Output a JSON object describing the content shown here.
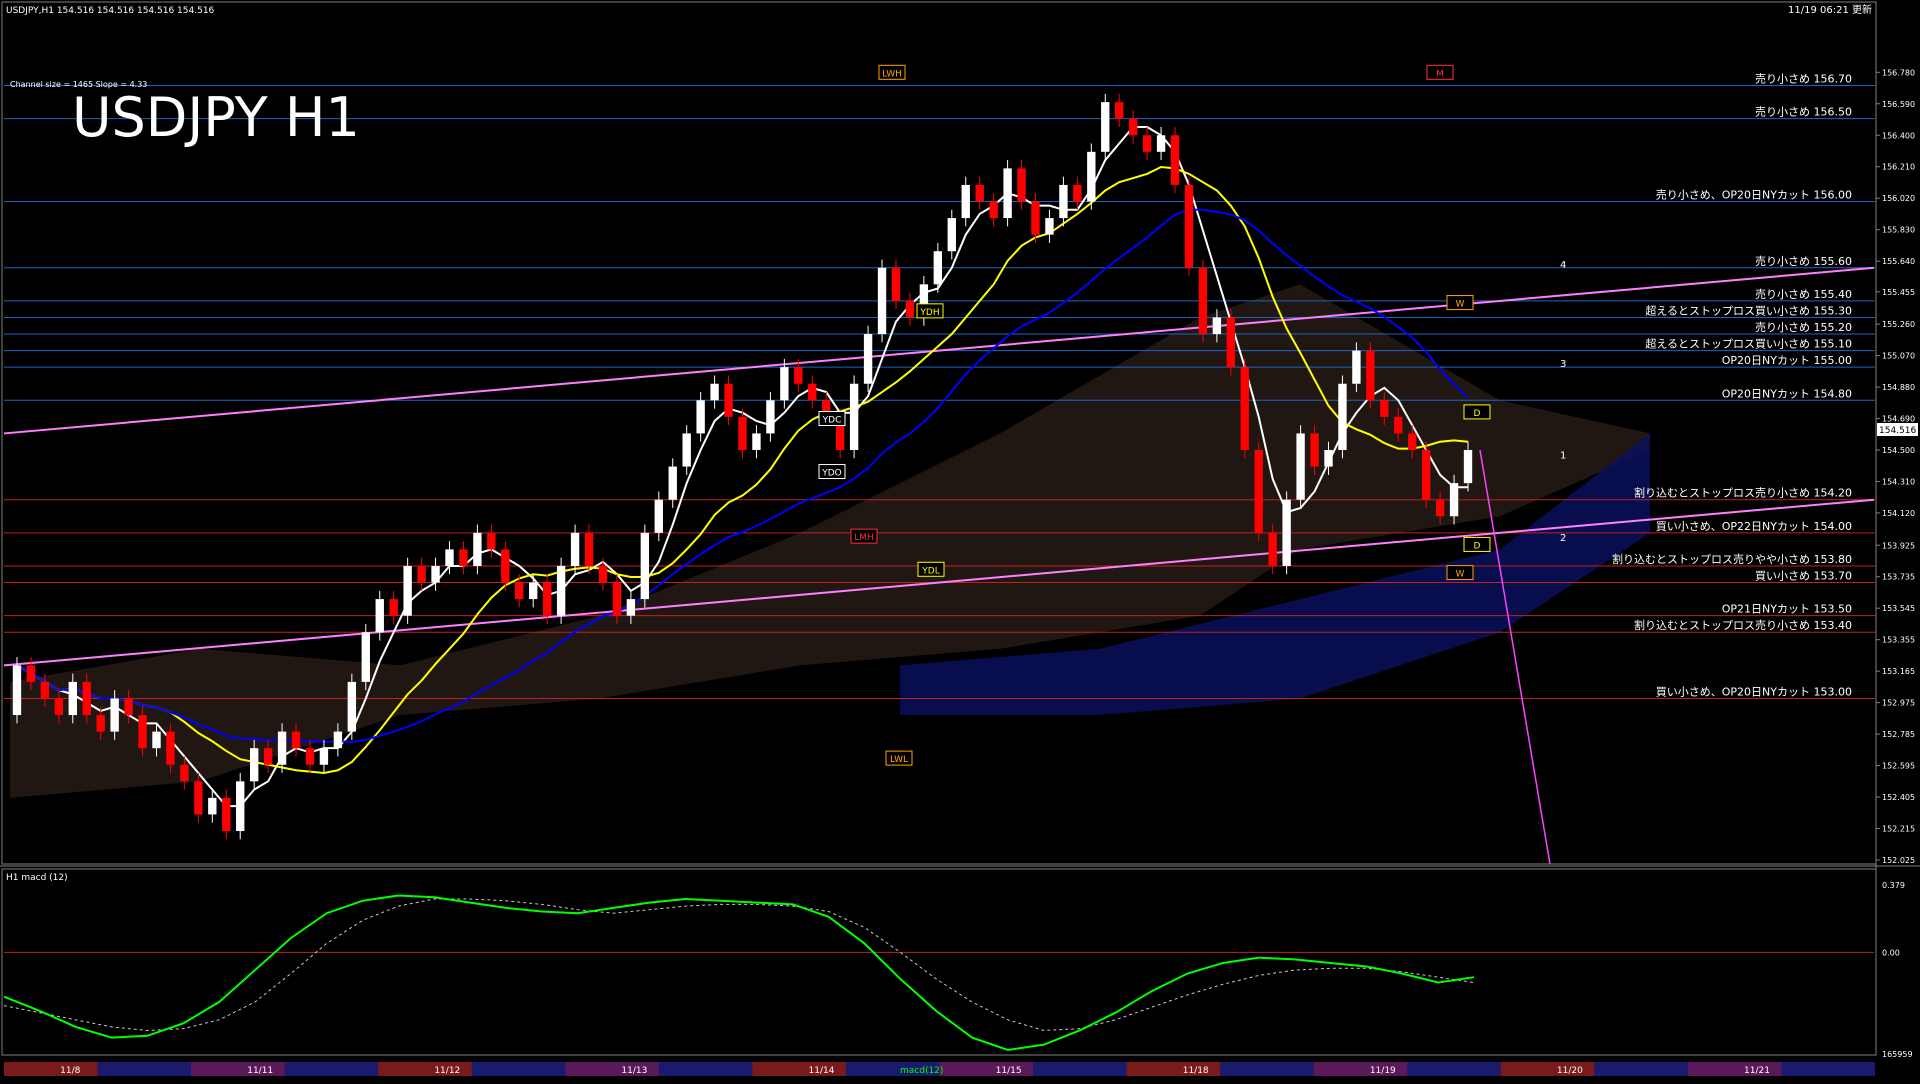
{
  "header": {
    "symbol_info": "USDJPY,H1  154.516 154.516 154.516 154.516",
    "timestamp": "11/19 06:21 更新",
    "channel_info": "Channel size = 1465 Slope = 4.33",
    "title": "USDJPY H1"
  },
  "colors": {
    "background": "#000000",
    "bull": "#ffffff",
    "bear": "#ff0000",
    "level": "#1e64c8",
    "support": "#c81e1e",
    "channel": "#ff80ff",
    "ma_fast": "#ffffff",
    "ma_mid": "#ffff00",
    "ma_slow": "#0000ff",
    "kijun": "#00c800",
    "macd": "#00ff00",
    "macd_neg": "#ff8080"
  },
  "chart_data": [
    {
      "type": "candlestick",
      "title": "USDJPY H1",
      "ylim": [
        152.025,
        156.975
      ],
      "y_ticks": [
        "156.780",
        "156.590",
        "156.400",
        "156.210",
        "156.020",
        "155.830",
        "155.640",
        "155.455",
        "155.260",
        "155.070",
        "154.880",
        "154.690",
        "154.500",
        "154.310",
        "154.120",
        "153.925",
        "153.735",
        "153.545",
        "153.355",
        "153.165",
        "152.975",
        "152.785",
        "152.595",
        "152.405",
        "152.215",
        "152.025"
      ],
      "current_price": "154.516",
      "x_ticks": [
        "11/8",
        "11/11",
        "11/12",
        "11/13",
        "11/14",
        "11/15",
        "11/18",
        "11/19",
        "11/20",
        "11/21"
      ],
      "levels": [
        {
          "price": 156.7,
          "label": "売り小さめ 156.70",
          "side": "sell"
        },
        {
          "price": 156.5,
          "label": "売り小さめ 156.50",
          "side": "sell"
        },
        {
          "price": 156.0,
          "label": "売り小さめ、OP20日NYカット 156.00",
          "side": "sell"
        },
        {
          "price": 155.6,
          "label": "売り小さめ 155.60",
          "side": "sell"
        },
        {
          "price": 155.4,
          "label": "売り小さめ 155.40",
          "side": "sell"
        },
        {
          "price": 155.3,
          "label": "超えるとストップロス買い小さめ 155.30",
          "side": "sell"
        },
        {
          "price": 155.2,
          "label": "売り小さめ 155.20",
          "side": "sell"
        },
        {
          "price": 155.1,
          "label": "超えるとストップロス買い小さめ 155.10",
          "side": "sell"
        },
        {
          "price": 155.0,
          "label": "OP20日NYカット 155.00",
          "side": "sell"
        },
        {
          "price": 154.8,
          "label": "OP20日NYカット 154.80",
          "side": "sell"
        },
        {
          "price": 154.2,
          "label": "割り込むとストップロス売り小さめ 154.20",
          "side": "buy"
        },
        {
          "price": 154.0,
          "label": "買い小さめ、OP22日NYカット 154.00",
          "side": "buy"
        },
        {
          "price": 153.8,
          "label": "割り込むとストップロス売りやや小さめ 153.80",
          "side": "buy"
        },
        {
          "price": 153.7,
          "label": "買い小さめ 153.70",
          "side": "buy"
        },
        {
          "price": 153.5,
          "label": "OP21日NYカット 153.50",
          "side": "buy"
        },
        {
          "price": 153.4,
          "label": "割り込むとストップロス売り小さめ 153.40",
          "side": "buy"
        },
        {
          "price": 153.0,
          "label": "買い小さめ、OP20日NYカット 153.00",
          "side": "buy"
        }
      ],
      "markers": [
        "LWH",
        "M",
        "YDH",
        "YDC",
        "YDO",
        "LMH",
        "YDL",
        "LWL",
        "W",
        "D",
        "W",
        "D"
      ],
      "channel_labels": [
        "4",
        "3",
        "1",
        "2"
      ],
      "candles": [
        [
          152.9,
          153.2
        ],
        [
          153.2,
          153.1
        ],
        [
          153.1,
          153.0
        ],
        [
          153.0,
          152.9
        ],
        [
          152.9,
          153.1
        ],
        [
          153.1,
          152.9
        ],
        [
          152.9,
          152.8
        ],
        [
          152.8,
          153.0
        ],
        [
          153.0,
          152.9
        ],
        [
          152.9,
          152.7
        ],
        [
          152.7,
          152.8
        ],
        [
          152.8,
          152.6
        ],
        [
          152.6,
          152.5
        ],
        [
          152.5,
          152.3
        ],
        [
          152.3,
          152.4
        ],
        [
          152.4,
          152.2
        ],
        [
          152.2,
          152.5
        ],
        [
          152.5,
          152.7
        ],
        [
          152.7,
          152.6
        ],
        [
          152.6,
          152.8
        ],
        [
          152.8,
          152.7
        ],
        [
          152.7,
          152.6
        ],
        [
          152.6,
          152.7
        ],
        [
          152.7,
          152.8
        ],
        [
          152.8,
          153.1
        ],
        [
          153.1,
          153.4
        ],
        [
          153.4,
          153.6
        ],
        [
          153.6,
          153.5
        ],
        [
          153.5,
          153.8
        ],
        [
          153.8,
          153.7
        ],
        [
          153.7,
          153.8
        ],
        [
          153.8,
          153.9
        ],
        [
          153.9,
          153.8
        ],
        [
          153.8,
          154.0
        ],
        [
          154.0,
          153.9
        ],
        [
          153.9,
          153.7
        ],
        [
          153.7,
          153.6
        ],
        [
          153.6,
          153.7
        ],
        [
          153.7,
          153.5
        ],
        [
          153.5,
          153.8
        ],
        [
          153.8,
          154.0
        ],
        [
          154.0,
          153.8
        ],
        [
          153.8,
          153.7
        ],
        [
          153.7,
          153.5
        ],
        [
          153.5,
          153.6
        ],
        [
          153.6,
          154.0
        ],
        [
          154.0,
          154.2
        ],
        [
          154.2,
          154.4
        ],
        [
          154.4,
          154.6
        ],
        [
          154.6,
          154.8
        ],
        [
          154.8,
          154.9
        ],
        [
          154.9,
          154.7
        ],
        [
          154.7,
          154.5
        ],
        [
          154.5,
          154.6
        ],
        [
          154.6,
          154.8
        ],
        [
          154.8,
          155.0
        ],
        [
          155.0,
          154.9
        ],
        [
          154.9,
          154.8
        ],
        [
          154.8,
          154.7
        ],
        [
          154.7,
          154.5
        ],
        [
          154.5,
          154.9
        ],
        [
          154.9,
          155.2
        ],
        [
          155.2,
          155.6
        ],
        [
          155.6,
          155.4
        ],
        [
          155.4,
          155.3
        ],
        [
          155.3,
          155.5
        ],
        [
          155.5,
          155.7
        ],
        [
          155.7,
          155.9
        ],
        [
          155.9,
          156.1
        ],
        [
          156.1,
          156.0
        ],
        [
          156.0,
          155.9
        ],
        [
          155.9,
          156.2
        ],
        [
          156.2,
          156.0
        ],
        [
          156.0,
          155.8
        ],
        [
          155.8,
          155.9
        ],
        [
          155.9,
          156.1
        ],
        [
          156.1,
          156.0
        ],
        [
          156.0,
          156.3
        ],
        [
          156.3,
          156.6
        ],
        [
          156.6,
          156.5
        ],
        [
          156.5,
          156.4
        ],
        [
          156.4,
          156.3
        ],
        [
          156.3,
          156.4
        ],
        [
          156.4,
          156.1
        ],
        [
          156.1,
          155.6
        ],
        [
          155.6,
          155.2
        ],
        [
          155.2,
          155.3
        ],
        [
          155.3,
          155.0
        ],
        [
          155.0,
          154.5
        ],
        [
          154.5,
          154.0
        ],
        [
          154.0,
          153.8
        ],
        [
          153.8,
          154.2
        ],
        [
          154.2,
          154.6
        ],
        [
          154.6,
          154.4
        ],
        [
          154.4,
          154.5
        ],
        [
          154.5,
          154.9
        ],
        [
          154.9,
          155.1
        ],
        [
          155.1,
          154.8
        ],
        [
          154.8,
          154.7
        ],
        [
          154.7,
          154.6
        ],
        [
          154.6,
          154.5
        ],
        [
          154.5,
          154.2
        ],
        [
          154.2,
          154.1
        ],
        [
          154.1,
          154.3
        ],
        [
          154.3,
          154.5
        ]
      ]
    },
    {
      "type": "line",
      "title": "H1 macd (12)",
      "y_ticks": [
        "0.379",
        "0.00",
        "165959"
      ],
      "ylim": [
        -0.55,
        0.379
      ],
      "signal": [
        -0.3,
        -0.34,
        -0.38,
        -0.42,
        -0.44,
        -0.43,
        -0.38,
        -0.28,
        -0.12,
        0.05,
        0.18,
        0.26,
        0.3,
        0.3,
        0.29,
        0.27,
        0.24,
        0.22,
        0.24,
        0.26,
        0.27,
        0.27,
        0.26,
        0.23,
        0.14,
        0.0,
        -0.15,
        -0.28,
        -0.38,
        -0.44,
        -0.43,
        -0.38,
        -0.31,
        -0.24,
        -0.18,
        -0.13,
        -0.1,
        -0.09,
        -0.09,
        -0.11,
        -0.14,
        -0.17
      ],
      "macd": [
        -0.25,
        -0.33,
        -0.42,
        -0.48,
        -0.47,
        -0.4,
        -0.28,
        -0.1,
        0.08,
        0.22,
        0.29,
        0.32,
        0.31,
        0.28,
        0.25,
        0.23,
        0.22,
        0.25,
        0.28,
        0.3,
        0.29,
        0.28,
        0.27,
        0.2,
        0.05,
        -0.15,
        -0.33,
        -0.48,
        -0.55,
        -0.52,
        -0.44,
        -0.34,
        -0.22,
        -0.12,
        -0.06,
        -0.03,
        -0.04,
        -0.06,
        -0.08,
        -0.12,
        -0.17,
        -0.14
      ]
    }
  ],
  "footer": {
    "indicator_tag": "macd(12)"
  }
}
